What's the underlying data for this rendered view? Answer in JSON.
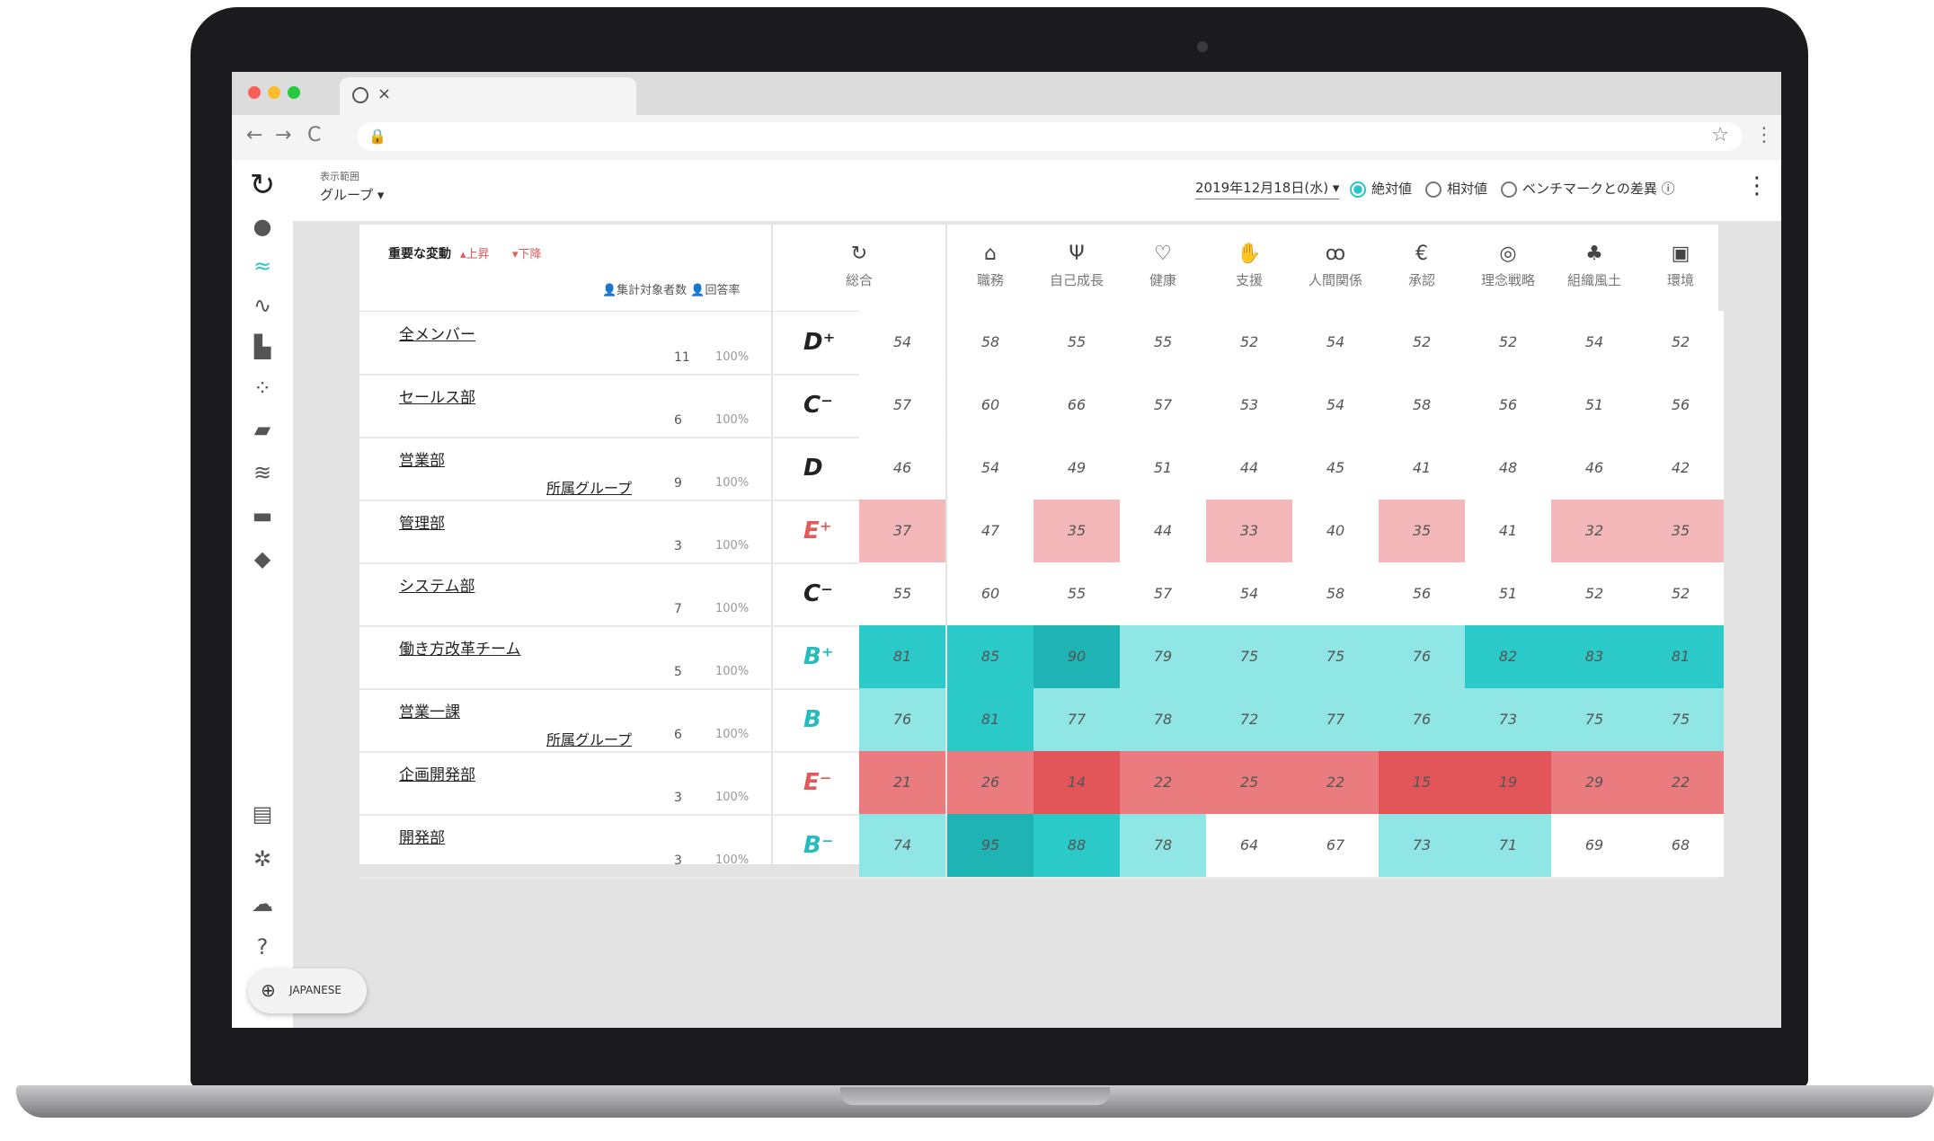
{
  "browser": {
    "tab_icon": "circle-icon",
    "tab_close": "×",
    "back": "←",
    "forward": "→",
    "reload": "C",
    "lock": "🔒",
    "star": "☆",
    "menu": "⋮"
  },
  "topbar": {
    "group_label_small": "表示範囲",
    "group_select": "グループ ▾",
    "date_select": "2019年12月18日(水) ▾",
    "options": [
      "絶対値",
      "相対値",
      "ベンチマークとの差異 ⓘ"
    ],
    "selected_option": "絶対値",
    "kebab": "⋮"
  },
  "sidebar": {
    "icons": [
      "logo-icon",
      "person-icon",
      "trend-icon",
      "line-chart-icon",
      "building-icon",
      "person-dots-icon",
      "chat-icon",
      "wifi-icon",
      "folder-icon",
      "graduation-icon"
    ],
    "bottom_icons": [
      "book-icon",
      "gear-icon",
      "cloud-icon",
      "help-icon"
    ]
  },
  "table": {
    "header_title": "重要な変動",
    "header_up": "▴上昇",
    "header_down": "▾下降",
    "header_legend": "👤集計対象者数  👤回答率",
    "total_label": "総合",
    "columns": [
      {
        "label": "職務",
        "icon": "briefcase-icon"
      },
      {
        "label": "自己成長",
        "icon": "sprout-icon"
      },
      {
        "label": "健康",
        "icon": "heart-icon"
      },
      {
        "label": "支援",
        "icon": "handshake-icon"
      },
      {
        "label": "人間関係",
        "icon": "people-icon"
      },
      {
        "label": "承認",
        "icon": "badge-icon"
      },
      {
        "label": "理念戦略",
        "icon": "compass-icon"
      },
      {
        "label": "組織風土",
        "icon": "tree-icon"
      },
      {
        "label": "環境",
        "icon": "document-icon"
      }
    ],
    "rows": [
      {
        "name": "全メンバー",
        "group": "",
        "count": "11",
        "pct": "100%",
        "grade": "D⁺",
        "grade_color": "#222222",
        "total": "54",
        "scores": [
          "58",
          "55",
          "55",
          "52",
          "54",
          "52",
          "52",
          "54",
          "52"
        ],
        "total_bg": "#ffffff",
        "bgs": [
          "#ffffff",
          "#ffffff",
          "#ffffff",
          "#ffffff",
          "#ffffff",
          "#ffffff",
          "#ffffff",
          "#ffffff",
          "#ffffff"
        ]
      },
      {
        "name": "セールス部",
        "group": "",
        "count": "6",
        "pct": "100%",
        "grade": "C⁻",
        "grade_color": "#222222",
        "total": "57",
        "scores": [
          "60",
          "66",
          "57",
          "53",
          "54",
          "58",
          "56",
          "51",
          "56"
        ],
        "total_bg": "#ffffff",
        "bgs": [
          "#ffffff",
          "#ffffff",
          "#ffffff",
          "#ffffff",
          "#ffffff",
          "#ffffff",
          "#ffffff",
          "#ffffff",
          "#ffffff"
        ]
      },
      {
        "name": "営業部",
        "group": "所属グループ",
        "count": "9",
        "pct": "100%",
        "grade": "D",
        "grade_color": "#222222",
        "total": "46",
        "scores": [
          "54",
          "49",
          "51",
          "44",
          "45",
          "41",
          "48",
          "46",
          "42"
        ],
        "total_bg": "#ffffff",
        "bgs": [
          "#ffffff",
          "#ffffff",
          "#ffffff",
          "#ffffff",
          "#ffffff",
          "#ffffff",
          "#ffffff",
          "#ffffff",
          "#ffffff"
        ]
      },
      {
        "name": "管理部",
        "group": "",
        "count": "3",
        "pct": "100%",
        "grade": "E⁺",
        "grade_color": "#e05a5a",
        "total": "37",
        "scores": [
          "47",
          "35",
          "44",
          "33",
          "40",
          "35",
          "41",
          "32",
          "35"
        ],
        "total_bg": "#f4b8bb",
        "bgs": [
          "#ffffff",
          "#f4b8bb",
          "#ffffff",
          "#f4b8bb",
          "#ffffff",
          "#f4b8bb",
          "#ffffff",
          "#f4b8bb",
          "#f4b8bb"
        ]
      },
      {
        "name": "システム部",
        "group": "",
        "count": "7",
        "pct": "100%",
        "grade": "C⁻",
        "grade_color": "#222222",
        "total": "55",
        "scores": [
          "60",
          "55",
          "57",
          "54",
          "58",
          "56",
          "51",
          "52",
          "52"
        ],
        "total_bg": "#ffffff",
        "bgs": [
          "#ffffff",
          "#ffffff",
          "#ffffff",
          "#ffffff",
          "#ffffff",
          "#ffffff",
          "#ffffff",
          "#ffffff",
          "#ffffff"
        ]
      },
      {
        "name": "働き方改革チーム",
        "group": "",
        "count": "5",
        "pct": "100%",
        "grade": "B⁺",
        "grade_color": "#26bcbc",
        "total": "81",
        "scores": [
          "85",
          "90",
          "79",
          "75",
          "75",
          "76",
          "82",
          "83",
          "81"
        ],
        "total_bg": "#2cc9c9",
        "bgs": [
          "#2cc9c9",
          "#1fb3b3",
          "#8fe6e4",
          "#8fe6e4",
          "#8fe6e4",
          "#8fe6e4",
          "#2cc9c9",
          "#2cc9c9",
          "#2cc9c9"
        ]
      },
      {
        "name": "営業一課",
        "group": "所属グループ",
        "count": "6",
        "pct": "100%",
        "grade": "B",
        "grade_color": "#26bcbc",
        "total": "76",
        "scores": [
          "81",
          "77",
          "78",
          "72",
          "77",
          "76",
          "73",
          "75",
          "75"
        ],
        "total_bg": "#8fe6e4",
        "bgs": [
          "#2cc9c9",
          "#8fe6e4",
          "#8fe6e4",
          "#8fe6e4",
          "#8fe6e4",
          "#8fe6e4",
          "#8fe6e4",
          "#8fe6e4",
          "#8fe6e4"
        ]
      },
      {
        "name": "企画開発部",
        "group": "",
        "count": "3",
        "pct": "100%",
        "grade": "E⁻",
        "grade_color": "#e05a5a",
        "total": "21",
        "scores": [
          "26",
          "14",
          "22",
          "25",
          "22",
          "15",
          "19",
          "29",
          "22"
        ],
        "total_bg": "#ea7b7e",
        "bgs": [
          "#ea7b7e",
          "#e25558",
          "#ea7b7e",
          "#ea7b7e",
          "#ea7b7e",
          "#e25558",
          "#e25558",
          "#ea7b7e",
          "#ea7b7e"
        ]
      },
      {
        "name": "開発部",
        "group": "",
        "count": "3",
        "pct": "100%",
        "grade": "B⁻",
        "grade_color": "#26bcbc",
        "total": "74",
        "scores": [
          "95",
          "88",
          "78",
          "64",
          "67",
          "73",
          "71",
          "69",
          "68"
        ],
        "total_bg": "#8fe6e4",
        "bgs": [
          "#1fb3b3",
          "#2cc9c9",
          "#8fe6e4",
          "#ffffff",
          "#ffffff",
          "#8fe6e4",
          "#8fe6e4",
          "#ffffff",
          "#ffffff"
        ]
      }
    ]
  },
  "language": "JAPANESE"
}
